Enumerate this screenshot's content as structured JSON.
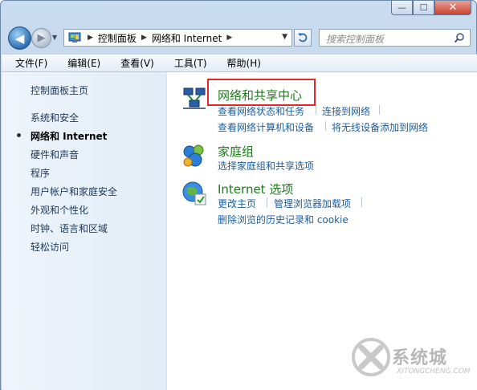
{
  "window": {
    "caption_buttons": {
      "minimize": "—",
      "maximize": "☐",
      "close": "✕"
    }
  },
  "nav": {
    "back_glyph": "◀",
    "forward_glyph": "▶",
    "breadcrumbs": [
      "控制面板",
      "网络和 Internet"
    ],
    "search_placeholder": "搜索控制面板"
  },
  "menu": [
    "文件(F)",
    "编辑(E)",
    "查看(V)",
    "工具(T)",
    "帮助(H)"
  ],
  "sidebar": {
    "home": "控制面板主页",
    "items": [
      "系统和安全",
      "网络和 Internet",
      "硬件和声音",
      "程序",
      "用户帐户和家庭安全",
      "外观和个性化",
      "时钟、语言和区域",
      "轻松访问"
    ],
    "current_index": 1
  },
  "categories": [
    {
      "title": "网络和共享中心",
      "icon": "network-center-icon",
      "links": [
        "查看网络状态和任务",
        "连接到网络",
        "查看网络计算机和设备",
        "将无线设备添加到网络"
      ],
      "highlighted": true
    },
    {
      "title": "家庭组",
      "icon": "homegroup-icon",
      "links": [
        "选择家庭组和共享选项"
      ]
    },
    {
      "title": "Internet 选项",
      "icon": "internet-options-icon",
      "links": [
        "更改主页",
        "管理浏览器加载项",
        "删除浏览的历史记录和 cookie"
      ]
    }
  ],
  "watermark": {
    "text": "系统城",
    "url": "XITONGCHENG.COM"
  },
  "colors": {
    "link": "#1c5d9c",
    "category_title": "#1d7b1d",
    "highlight_box": "#e3272b"
  }
}
